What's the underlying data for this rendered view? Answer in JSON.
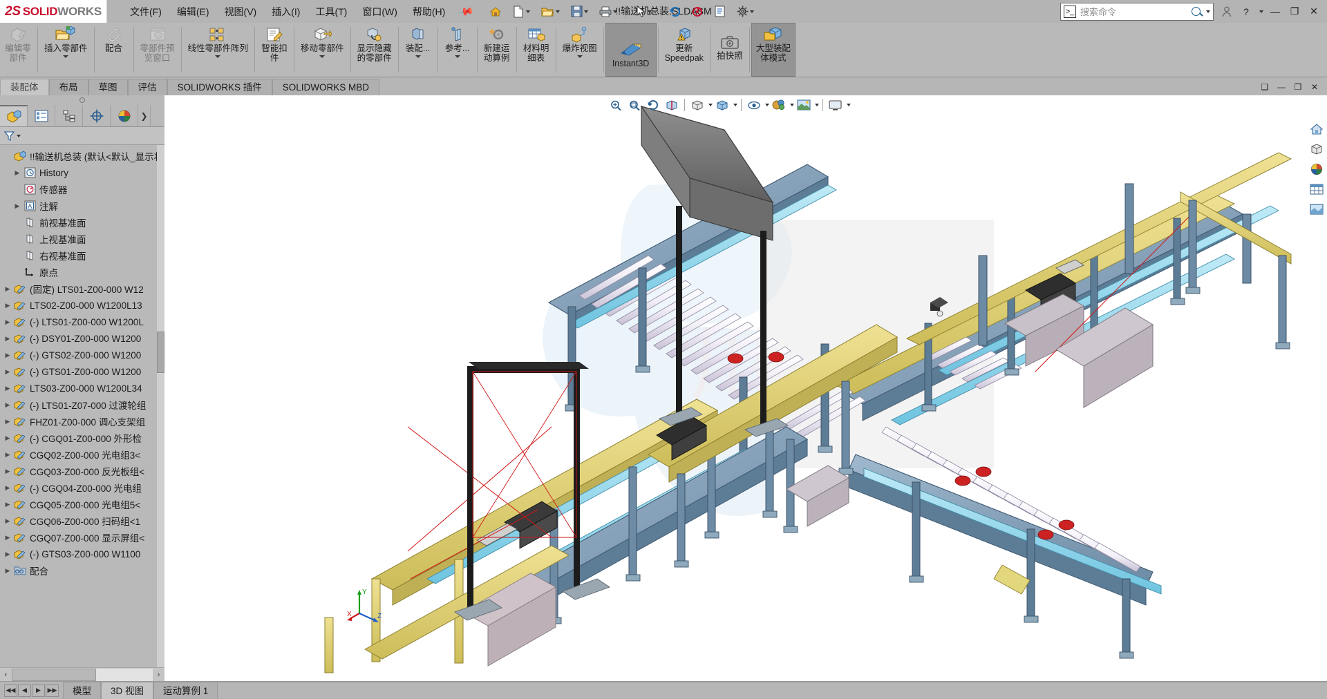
{
  "app": {
    "brand_ds": "2S",
    "brand_solid": "SOLID",
    "brand_works": "WORKS",
    "document_title": "!!输送机总装.SLDASM"
  },
  "menubar": {
    "items": [
      {
        "label": "文件(F)",
        "name": "menu-file"
      },
      {
        "label": "编辑(E)",
        "name": "menu-edit"
      },
      {
        "label": "视图(V)",
        "name": "menu-view"
      },
      {
        "label": "插入(I)",
        "name": "menu-insert"
      },
      {
        "label": "工具(T)",
        "name": "menu-tools"
      },
      {
        "label": "窗口(W)",
        "name": "menu-window"
      },
      {
        "label": "帮助(H)",
        "name": "menu-help"
      }
    ],
    "pin_icon": "pin-icon"
  },
  "quick_access": {
    "buttons": [
      {
        "name": "home-icon",
        "label": ""
      },
      {
        "name": "new-document-icon",
        "label": ""
      },
      {
        "name": "open-document-icon",
        "label": ""
      },
      {
        "name": "save-icon",
        "label": ""
      },
      {
        "name": "print-icon",
        "label": ""
      },
      {
        "name": "select-arrow-icon",
        "label": ""
      },
      {
        "name": "undo-icon",
        "label": ""
      },
      {
        "name": "rebuild-icon",
        "label": ""
      },
      {
        "name": "file-properties-icon",
        "label": ""
      },
      {
        "name": "options-gear-icon",
        "label": ""
      }
    ]
  },
  "search": {
    "placeholder": "搜索命令",
    "prompt_icon": "command-prompt-icon",
    "magnifier_icon": "search-icon",
    "dropdown_icon": "chevron-down-icon"
  },
  "window_controls": {
    "account_icon": "user-account-icon",
    "help_label": "?",
    "minimize_label": "—",
    "restore_label": "❐",
    "close_label": "✕"
  },
  "ribbon": {
    "buttons": [
      {
        "name": "edit-component-button",
        "label": "编辑零\n部件",
        "icon": "edit-component-icon",
        "state": "disabled",
        "dropdown": false
      },
      {
        "name": "insert-components-button",
        "label": "插入零部件",
        "icon": "insert-component-icon",
        "state": "normal",
        "dropdown": true
      },
      {
        "name": "mate-button",
        "label": "配合",
        "icon": "mate-paperclip-icon",
        "state": "normal",
        "dropdown": false
      },
      {
        "name": "component-preview-window-button",
        "label": "零部件预\n览窗口",
        "icon": "component-preview-icon",
        "state": "disabled",
        "dropdown": false
      },
      {
        "name": "linear-component-pattern-button",
        "label": "线性零部件阵列",
        "icon": "linear-pattern-icon",
        "state": "normal",
        "dropdown": true
      },
      {
        "name": "smart-fasteners-button",
        "label": "智能扣\n件",
        "icon": "smart-fastener-icon",
        "state": "normal",
        "dropdown": false
      },
      {
        "name": "move-component-button",
        "label": "移动零部件",
        "icon": "move-component-icon",
        "state": "normal",
        "dropdown": true
      },
      {
        "name": "show-hidden-components-button",
        "label": "显示隐藏\n的零部件",
        "icon": "show-hidden-icon",
        "state": "normal",
        "dropdown": false
      },
      {
        "name": "assembly-features-button",
        "label": "装配...",
        "icon": "assembly-features-icon",
        "state": "normal",
        "dropdown": true
      },
      {
        "name": "reference-geometry-button",
        "label": "参考...",
        "icon": "reference-geometry-icon",
        "state": "normal",
        "dropdown": true
      },
      {
        "name": "new-motion-study-button",
        "label": "新建运\n动算例",
        "icon": "motion-study-icon",
        "state": "normal",
        "dropdown": false
      },
      {
        "name": "bill-of-materials-button",
        "label": "材料明\n细表",
        "icon": "bom-icon",
        "state": "normal",
        "dropdown": false
      },
      {
        "name": "exploded-view-button",
        "label": "爆炸视图",
        "icon": "exploded-view-icon",
        "state": "normal",
        "dropdown": true
      },
      {
        "name": "instant3d-button",
        "label": "Instant3D",
        "icon": "instant3d-icon",
        "state": "active",
        "dropdown": false
      },
      {
        "name": "update-speedpak-button",
        "label": "更新\nSpeedpak",
        "icon": "update-speedpak-icon",
        "state": "normal",
        "dropdown": false
      },
      {
        "name": "take-snapshot-button",
        "label": "拍快照",
        "icon": "camera-icon",
        "state": "normal",
        "dropdown": false
      },
      {
        "name": "large-assembly-mode-button",
        "label": "大型装配\n体模式",
        "icon": "large-assembly-icon",
        "state": "active",
        "dropdown": false
      }
    ]
  },
  "command_tabs": {
    "items": [
      {
        "label": "装配体",
        "name": "tab-assembly",
        "selected": true
      },
      {
        "label": "布局",
        "name": "tab-layout",
        "selected": false
      },
      {
        "label": "草图",
        "name": "tab-sketch",
        "selected": false
      },
      {
        "label": "评估",
        "name": "tab-evaluate",
        "selected": false
      },
      {
        "label": "SOLIDWORKS 插件",
        "name": "tab-solidworks-addins",
        "selected": false
      },
      {
        "label": "SOLIDWORKS MBD",
        "name": "tab-solidworks-mbd",
        "selected": false
      }
    ],
    "right_controls": [
      {
        "name": "tile-window-icon",
        "label": "❑"
      },
      {
        "name": "minimize-doc-icon",
        "label": "—"
      },
      {
        "name": "restore-doc-icon",
        "label": "❐"
      },
      {
        "name": "close-doc-icon",
        "label": "✕"
      }
    ]
  },
  "left_panel": {
    "tabs": [
      {
        "name": "feature-manager-tab",
        "icon": "assembly-tree-icon",
        "selected": true
      },
      {
        "name": "property-manager-tab",
        "icon": "property-list-icon",
        "selected": false
      },
      {
        "name": "configuration-manager-tab",
        "icon": "configuration-icon",
        "selected": false
      },
      {
        "name": "dimxpert-manager-tab",
        "icon": "dimxpert-target-icon",
        "selected": false
      },
      {
        "name": "display-manager-tab",
        "icon": "display-sphere-icon",
        "selected": false
      },
      {
        "name": "more-tabs-button",
        "icon": "chevron-right-icon",
        "selected": false
      }
    ],
    "filter": {
      "name": "filter-funnel-icon",
      "dropdown_icon": "chevron-down-icon"
    },
    "tree": [
      {
        "label": "!!输送机总装 (默认<默认_显示状",
        "icon": "assembly-icon",
        "twist": false,
        "indent": 0,
        "name": "tree-root-assembly"
      },
      {
        "label": "History",
        "icon": "history-icon",
        "twist": true,
        "indent": 1,
        "name": "tree-item-history"
      },
      {
        "label": "传感器",
        "icon": "sensors-icon",
        "twist": false,
        "indent": 1,
        "name": "tree-item-sensors"
      },
      {
        "label": "注解",
        "icon": "annotations-icon",
        "twist": true,
        "indent": 1,
        "name": "tree-item-annotations"
      },
      {
        "label": "前视基准面",
        "icon": "plane-icon",
        "twist": false,
        "indent": 1,
        "name": "tree-item-front-plane"
      },
      {
        "label": "上视基准面",
        "icon": "plane-icon",
        "twist": false,
        "indent": 1,
        "name": "tree-item-top-plane"
      },
      {
        "label": "右视基准面",
        "icon": "plane-icon",
        "twist": false,
        "indent": 1,
        "name": "tree-item-right-plane"
      },
      {
        "label": "原点",
        "icon": "origin-icon",
        "twist": false,
        "indent": 1,
        "name": "tree-item-origin"
      },
      {
        "label": "(固定) LTS01-Z00-000 W12",
        "icon": "component-icon",
        "twist": true,
        "indent": 0,
        "name": "tree-item-lts01-fixed"
      },
      {
        "label": "LTS02-Z00-000 W1200L13",
        "icon": "component-icon",
        "twist": true,
        "indent": 0,
        "name": "tree-item-lts02"
      },
      {
        "label": "(-) LTS01-Z00-000 W1200L",
        "icon": "component-icon",
        "twist": true,
        "indent": 0,
        "name": "tree-item-lts01"
      },
      {
        "label": "(-) DSY01-Z00-000 W1200",
        "icon": "component-icon",
        "twist": true,
        "indent": 0,
        "name": "tree-item-dsy01"
      },
      {
        "label": "(-) GTS02-Z00-000 W1200",
        "icon": "component-icon",
        "twist": true,
        "indent": 0,
        "name": "tree-item-gts02"
      },
      {
        "label": "(-) GTS01-Z00-000 W1200",
        "icon": "component-icon",
        "twist": true,
        "indent": 0,
        "name": "tree-item-gts01"
      },
      {
        "label": "LTS03-Z00-000 W1200L34",
        "icon": "component-icon",
        "twist": true,
        "indent": 0,
        "name": "tree-item-lts03"
      },
      {
        "label": "(-) LTS01-Z07-000 过渡轮组",
        "icon": "component-icon",
        "twist": true,
        "indent": 0,
        "name": "tree-item-lts01-z07"
      },
      {
        "label": "FHZ01-Z00-000 调心支架组",
        "icon": "component-icon",
        "twist": true,
        "indent": 0,
        "name": "tree-item-fhz01"
      },
      {
        "label": "(-) CGQ01-Z00-000 外形检",
        "icon": "component-icon",
        "twist": true,
        "indent": 0,
        "name": "tree-item-cgq01"
      },
      {
        "label": "CGQ02-Z00-000 光电组3<",
        "icon": "component-icon",
        "twist": true,
        "indent": 0,
        "name": "tree-item-cgq02"
      },
      {
        "label": "CGQ03-Z00-000 反光板组<",
        "icon": "component-icon",
        "twist": true,
        "indent": 0,
        "name": "tree-item-cgq03"
      },
      {
        "label": "(-) CGQ04-Z00-000 光电组",
        "icon": "component-icon",
        "twist": true,
        "indent": 0,
        "name": "tree-item-cgq04"
      },
      {
        "label": "CGQ05-Z00-000 光电组5<",
        "icon": "component-icon",
        "twist": true,
        "indent": 0,
        "name": "tree-item-cgq05"
      },
      {
        "label": "CGQ06-Z00-000 扫码组<1",
        "icon": "component-icon",
        "twist": true,
        "indent": 0,
        "name": "tree-item-cgq06"
      },
      {
        "label": "CGQ07-Z00-000 显示屏组<",
        "icon": "component-icon",
        "twist": true,
        "indent": 0,
        "name": "tree-item-cgq07"
      },
      {
        "label": "(-) GTS03-Z00-000 W1100",
        "icon": "component-icon",
        "twist": true,
        "indent": 0,
        "name": "tree-item-gts03"
      },
      {
        "label": "配合",
        "icon": "mates-folder-icon",
        "twist": true,
        "indent": 0,
        "name": "tree-item-mates"
      }
    ],
    "hscroll": {
      "left_arrow": "‹",
      "right_arrow": "›"
    }
  },
  "view_toolbar": {
    "buttons": [
      {
        "name": "zoom-to-fit-icon"
      },
      {
        "name": "zoom-to-area-icon"
      },
      {
        "name": "previous-view-icon"
      },
      {
        "name": "section-view-icon"
      },
      {
        "name": "view-orientation-icon",
        "dropdown": true
      },
      {
        "name": "display-style-icon",
        "dropdown": true
      },
      {
        "name": "hide-show-items-icon",
        "dropdown": true
      },
      {
        "name": "edit-appearance-icon",
        "dropdown": true
      },
      {
        "name": "apply-scene-icon",
        "dropdown": true
      },
      {
        "name": "view-settings-icon",
        "dropdown": true
      }
    ]
  },
  "view_right_toolbar": {
    "buttons": [
      {
        "name": "view-home-icon"
      },
      {
        "name": "view-orientation-cube-icon"
      },
      {
        "name": "appearances-palette-icon"
      },
      {
        "name": "display-states-icon"
      },
      {
        "name": "custom-view-icon"
      }
    ]
  },
  "triad": {
    "x_label": "X",
    "y_label": "Y",
    "z_label": "Z"
  },
  "bottom_bar": {
    "nav_buttons": [
      {
        "name": "first-tab-button",
        "label": "◀◀"
      },
      {
        "name": "prev-tab-button",
        "label": "◀"
      },
      {
        "name": "next-tab-button",
        "label": "▶"
      },
      {
        "name": "last-tab-button",
        "label": "▶▶"
      }
    ],
    "tabs": [
      {
        "label": "模型",
        "name": "bottom-tab-model",
        "selected": false
      },
      {
        "label": "3D 视图",
        "name": "bottom-tab-3d-views",
        "selected": true
      },
      {
        "label": "运动算例 1",
        "name": "bottom-tab-motion-study-1",
        "selected": false
      }
    ]
  }
}
